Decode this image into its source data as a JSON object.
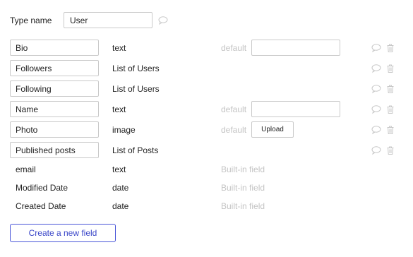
{
  "type_name": {
    "label": "Type name",
    "value": "User"
  },
  "fields": [
    {
      "name": "Bio",
      "type": "text",
      "default_label": "default",
      "default_kind": "input"
    },
    {
      "name": "Followers",
      "type": "List of Users"
    },
    {
      "name": "Following",
      "type": "List of Users"
    },
    {
      "name": "Name",
      "type": "text",
      "default_label": "default",
      "default_kind": "input"
    },
    {
      "name": "Photo",
      "type": "image",
      "default_label": "default",
      "default_kind": "upload",
      "upload_label": "Upload"
    },
    {
      "name": "Published posts",
      "type": "List of Posts"
    }
  ],
  "builtin_fields": [
    {
      "name": "email",
      "type": "text",
      "note": "Built-in field"
    },
    {
      "name": "Modified Date",
      "type": "date",
      "note": "Built-in field"
    },
    {
      "name": "Created Date",
      "type": "date",
      "note": "Built-in field"
    }
  ],
  "create_button_label": "Create a new field",
  "icons": {
    "comment": "comment-icon",
    "trash": "trash-icon"
  },
  "colors": {
    "accent": "#3a46c8",
    "muted": "#c4c4c4",
    "border": "#c9c9c9"
  }
}
